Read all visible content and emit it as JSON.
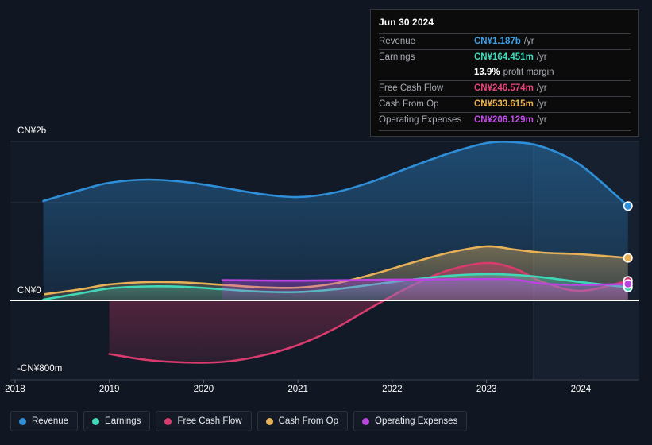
{
  "tooltip": {
    "date": "Jun 30 2024",
    "rows": [
      {
        "label": "Revenue",
        "value": "CN¥1.187b",
        "unit": "/yr",
        "color": "#3aa0e8"
      },
      {
        "label": "Earnings",
        "value": "CN¥164.451m",
        "unit": "/yr",
        "color": "#3fdcbc"
      },
      {
        "label": "",
        "value": "13.9%",
        "unit": "profit margin",
        "color": "#ffffff"
      },
      {
        "label": "Free Cash Flow",
        "value": "CN¥246.574m",
        "unit": "/yr",
        "color": "#e8447e"
      },
      {
        "label": "Cash From Op",
        "value": "CN¥533.615m",
        "unit": "/yr",
        "color": "#eeb24c"
      },
      {
        "label": "Operating Expenses",
        "value": "CN¥206.129m",
        "unit": "/yr",
        "color": "#c44ce8"
      }
    ]
  },
  "legend": {
    "items": [
      {
        "label": "Revenue",
        "color": "#2e8fd8"
      },
      {
        "label": "Earnings",
        "color": "#3fd9b8"
      },
      {
        "label": "Free Cash Flow",
        "color": "#d93b6e"
      },
      {
        "label": "Cash From Op",
        "color": "#e8b157"
      },
      {
        "label": "Operating Expenses",
        "color": "#bb44e0"
      }
    ]
  },
  "chart_data": {
    "type": "area",
    "title": "",
    "xlabel": "",
    "ylabel": "",
    "currency": "CN¥",
    "grid": true,
    "legend_position": "bottom",
    "y_axis_labels": [
      "CN¥2b",
      "CN¥0",
      "-CN¥800m"
    ],
    "y_axis_values": [
      2000,
      0,
      -800
    ],
    "ylim": [
      -800,
      2000
    ],
    "x_tick_labels": [
      "2018",
      "2019",
      "2020",
      "2021",
      "2022",
      "2023",
      "2024"
    ],
    "x_tick_values": [
      2018,
      2019,
      2020,
      2021,
      2022,
      2023,
      2024
    ],
    "forecast_divider_x": 2023.5,
    "units_note": "values in millions CN¥",
    "series": [
      {
        "name": "Revenue",
        "color": "#2e8fd8",
        "x": [
          2018.3,
          2018.7,
          2019.0,
          2019.4,
          2019.8,
          2020.2,
          2020.6,
          2021.0,
          2021.4,
          2021.8,
          2022.2,
          2022.6,
          2023.0,
          2023.3,
          2023.6,
          2024.0,
          2024.5
        ],
        "values": [
          1250,
          1390,
          1480,
          1520,
          1490,
          1420,
          1340,
          1300,
          1360,
          1500,
          1680,
          1850,
          1980,
          1990,
          1930,
          1700,
          1187
        ]
      },
      {
        "name": "Earnings",
        "color": "#3fd9b8",
        "x": [
          2018.3,
          2018.7,
          2019.0,
          2019.4,
          2019.8,
          2020.2,
          2020.6,
          2021.0,
          2021.4,
          2021.8,
          2022.2,
          2022.6,
          2023.0,
          2023.3,
          2023.6,
          2024.0,
          2024.5
        ],
        "values": [
          10,
          90,
          150,
          175,
          170,
          140,
          110,
          105,
          140,
          200,
          260,
          310,
          330,
          320,
          290,
          230,
          164
        ]
      },
      {
        "name": "Free Cash Flow",
        "color": "#d93b6e",
        "x": [
          2019.0,
          2019.4,
          2019.8,
          2020.2,
          2020.6,
          2021.0,
          2021.4,
          2021.8,
          2022.2,
          2022.6,
          2023.0,
          2023.3,
          2023.6,
          2024.0,
          2024.5
        ],
        "values": [
          -540,
          -600,
          -625,
          -620,
          -560,
          -450,
          -280,
          -60,
          180,
          380,
          470,
          400,
          230,
          120,
          247
        ]
      },
      {
        "name": "Cash From Op",
        "color": "#e8b157",
        "x": [
          2018.3,
          2018.7,
          2019.0,
          2019.4,
          2019.8,
          2020.2,
          2020.6,
          2021.0,
          2021.4,
          2021.8,
          2022.2,
          2022.6,
          2023.0,
          2023.3,
          2023.6,
          2024.0,
          2024.5
        ],
        "values": [
          75,
          140,
          200,
          230,
          225,
          195,
          165,
          160,
          215,
          330,
          470,
          600,
          680,
          640,
          600,
          580,
          534
        ]
      },
      {
        "name": "Operating Expenses",
        "color": "#bb44e0",
        "x": [
          2020.2,
          2020.6,
          2021.0,
          2021.4,
          2021.8,
          2022.2,
          2022.6,
          2023.0,
          2023.3,
          2023.6,
          2024.0,
          2024.5
        ],
        "values": [
          255,
          250,
          248,
          252,
          258,
          262,
          265,
          268,
          262,
          210,
          195,
          206
        ]
      }
    ]
  }
}
